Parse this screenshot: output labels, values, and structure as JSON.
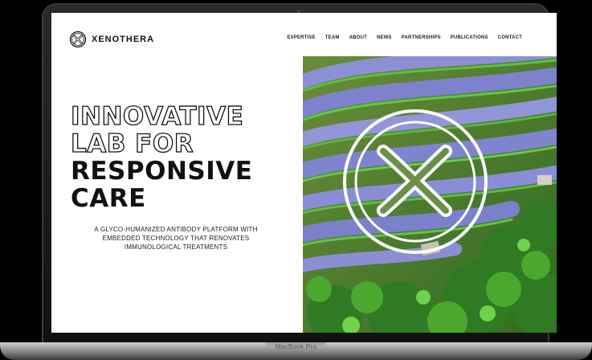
{
  "brand": {
    "name": "XENOTHERA"
  },
  "nav": {
    "items": [
      "EXPERTISE",
      "TEAM",
      "ABOUT",
      "NEWS",
      "PARTNERSHIPS",
      "PUBLICATIONS",
      "CONTACT"
    ]
  },
  "hero": {
    "headline_outline_1": "INNOVATIVE",
    "headline_outline_2": "LAB FOR",
    "headline_solid_1": "RESPONSIVE",
    "headline_solid_2": "CARE",
    "subtext_1": "A GLYCO-HUMANIZED ANTIBODY PLATFORM WITH",
    "subtext_2": "EMBEDDED TECHNOLOGY THAT RENOVATES",
    "subtext_3": "IMMUNOLOGICAL TREATMENTS"
  },
  "device": {
    "label": "MacBook Pro"
  },
  "colors": {
    "accent": "#111111",
    "terrace_water": "#8a8ad0",
    "terrace_green": "#4caf3a"
  }
}
